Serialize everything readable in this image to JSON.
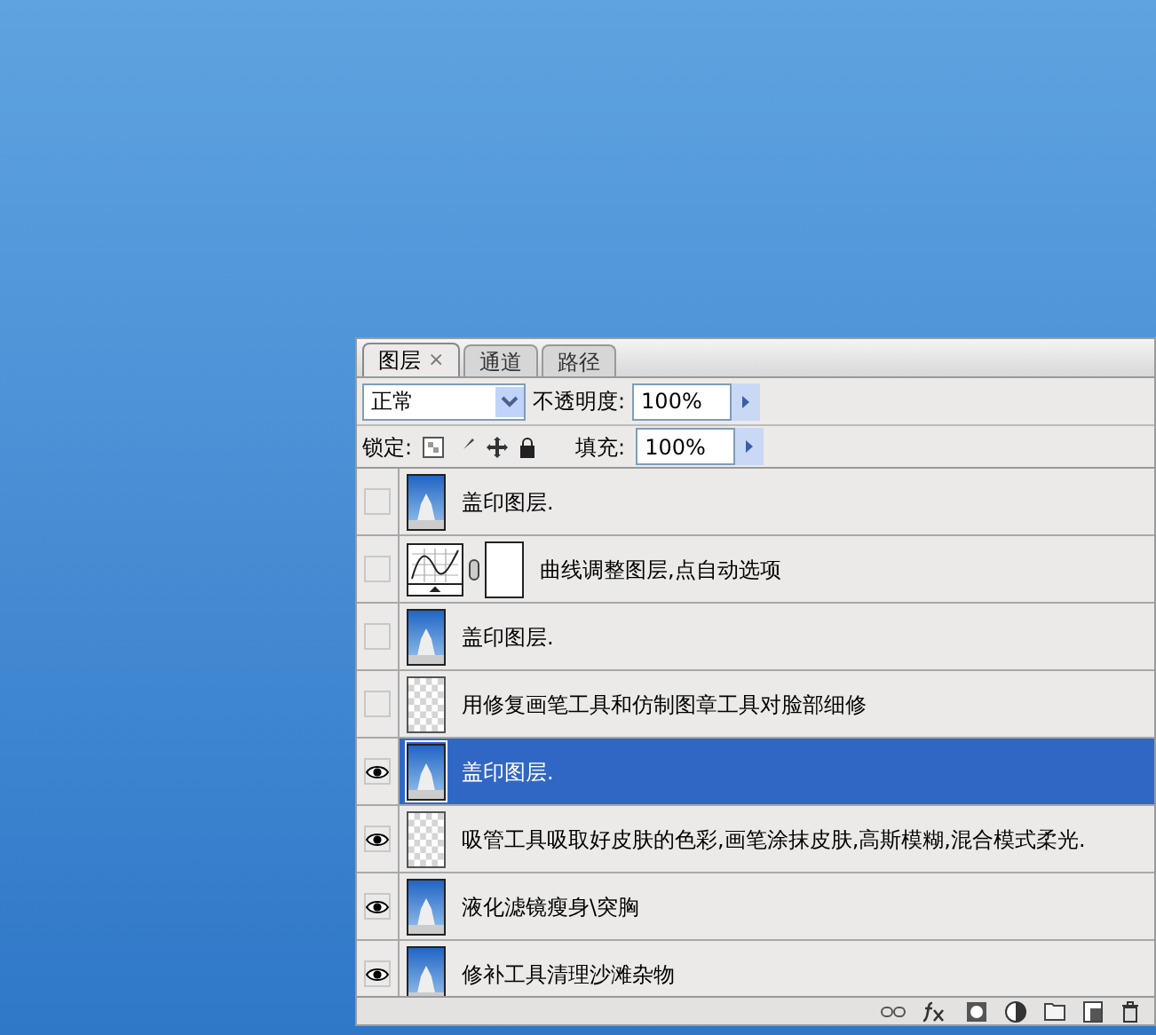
{
  "tabs": [
    {
      "label": "图层",
      "close": "×",
      "selected": true
    },
    {
      "label": "通道",
      "selected": false
    },
    {
      "label": "路径",
      "selected": false
    }
  ],
  "blend_mode": {
    "value": "正常"
  },
  "opacity": {
    "label": "不透明度:",
    "value": "100%"
  },
  "lock": {
    "label": "锁定:"
  },
  "fill": {
    "label": "填充:",
    "value": "100%"
  },
  "layers": [
    {
      "name": "盖印图层.",
      "kind": "image",
      "visible": false,
      "selected": false
    },
    {
      "name": "曲线调整图层,点自动选项",
      "kind": "curves",
      "visible": false,
      "selected": false
    },
    {
      "name": "盖印图层.",
      "kind": "image",
      "visible": false,
      "selected": false
    },
    {
      "name": "用修复画笔工具和仿制图章工具对脸部细修",
      "kind": "transparent",
      "visible": false,
      "selected": false
    },
    {
      "name": "盖印图层.",
      "kind": "image",
      "visible": true,
      "selected": true
    },
    {
      "name": "吸管工具吸取好皮肤的色彩,画笔涂抹皮肤,高斯模糊,混合模式柔光.",
      "kind": "transparent",
      "visible": true,
      "selected": false
    },
    {
      "name": "液化滤镜瘦身\\突胸",
      "kind": "image",
      "visible": true,
      "selected": false
    },
    {
      "name": "修补工具清理沙滩杂物",
      "kind": "image",
      "visible": true,
      "selected": false
    }
  ]
}
